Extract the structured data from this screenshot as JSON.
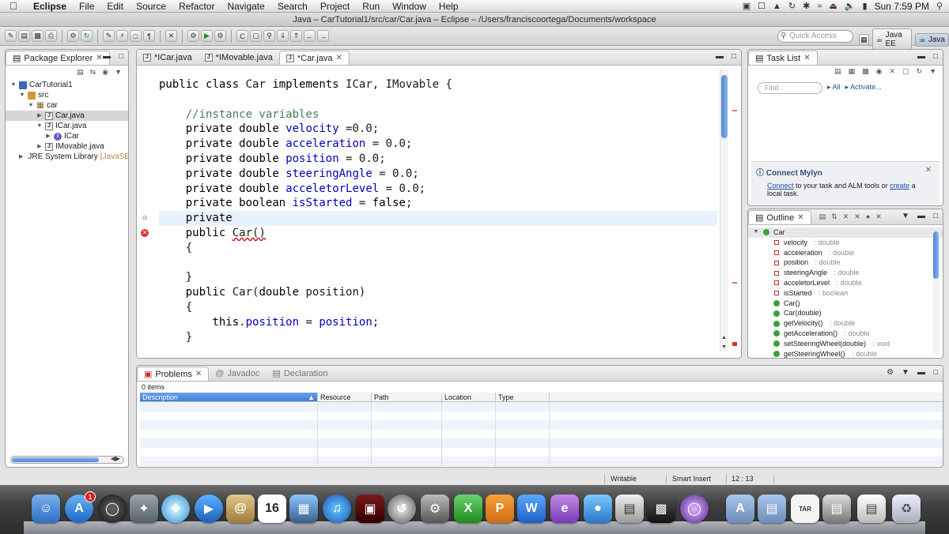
{
  "menubar": {
    "app": "Eclipse",
    "items": [
      "File",
      "Edit",
      "Source",
      "Refactor",
      "Navigate",
      "Search",
      "Project",
      "Run",
      "Window",
      "Help"
    ],
    "clock": "Sun 7:59 PM"
  },
  "window": {
    "title": "Java – CarTutorial1/src/car/Car.java – Eclipse – /Users/franciscoortega/Documents/workspace"
  },
  "toolbar": {
    "quick_access_placeholder": "Quick Access",
    "perspectives": [
      "Java EE",
      "Java"
    ]
  },
  "package_explorer": {
    "tab": "Package Explorer",
    "tree": [
      {
        "label": "CarTutorial1",
        "depth": 0,
        "icon": "project-icon",
        "expanded": true
      },
      {
        "label": "src",
        "depth": 1,
        "icon": "source-folder-icon",
        "expanded": true
      },
      {
        "label": "car",
        "depth": 2,
        "icon": "package-icon",
        "expanded": true
      },
      {
        "label": "Car.java",
        "depth": 3,
        "icon": "java-file-icon",
        "selected": true
      },
      {
        "label": "ICar.java",
        "depth": 3,
        "icon": "java-file-icon",
        "expanded": true
      },
      {
        "label": "ICar",
        "depth": 4,
        "icon": "interface-icon"
      },
      {
        "label": "IMovable.java",
        "depth": 3,
        "icon": "java-file-icon"
      },
      {
        "label": "JRE System Library",
        "suffix": "[JavaSE-",
        "depth": 1,
        "icon": "library-icon"
      }
    ]
  },
  "editor": {
    "tabs": [
      {
        "label": "*ICar.java",
        "active": false
      },
      {
        "label": "*IMovable.java",
        "active": false
      },
      {
        "label": "*Car.java",
        "active": true
      }
    ],
    "lines": [
      "public class Car implements ICar, IMovable {",
      "",
      "    //instance variables",
      "    private double velocity =0.0;",
      "    private double acceleration = 0.0;",
      "    private double position = 0.0;",
      "    private double steeringAngle = 0.0;",
      "    private double acceletorLevel = 0.0;",
      "    private boolean isStarted = false;",
      "    private",
      "    public Car()",
      "    {",
      "",
      "    }",
      "    public Car(double position)",
      "    {",
      "        this.position = position;",
      "    }"
    ],
    "current_line": 10,
    "error_line": 11
  },
  "task_list": {
    "tab": "Task List",
    "find_placeholder": "Find",
    "filter_all": "All",
    "activate": "Activate...",
    "mylyn": {
      "title": "Connect Mylyn",
      "text_link1": "Connect",
      "text_mid": " to your task and ALM tools or ",
      "text_link2": "create",
      "text_end": " a local task."
    }
  },
  "outline": {
    "tab": "Outline",
    "root": "Car",
    "members": [
      {
        "name": "velocity",
        "type": ": double",
        "kind": "field"
      },
      {
        "name": "acceleration",
        "type": ": double",
        "kind": "field"
      },
      {
        "name": "position",
        "type": ": double",
        "kind": "field"
      },
      {
        "name": "steeringAngle",
        "type": ": double",
        "kind": "field"
      },
      {
        "name": "acceletorLevel",
        "type": ": double",
        "kind": "field"
      },
      {
        "name": "isStarted",
        "type": ": boolean",
        "kind": "field"
      },
      {
        "name": "Car()",
        "type": "",
        "kind": "constructor"
      },
      {
        "name": "Car(double)",
        "type": "",
        "kind": "constructor"
      },
      {
        "name": "getVelocity()",
        "type": ": double",
        "kind": "method"
      },
      {
        "name": "getAcceleration()",
        "type": ": double",
        "kind": "method"
      },
      {
        "name": "setSteeringWheel(double)",
        "type": ": void",
        "kind": "method"
      },
      {
        "name": "getSteeringWheel()",
        "type": ": double",
        "kind": "method"
      }
    ]
  },
  "problems": {
    "tabs": [
      "Problems",
      "Javadoc",
      "Declaration"
    ],
    "count": "0 items",
    "columns": [
      "Description",
      "Resource",
      "Path",
      "Location",
      "Type"
    ]
  },
  "status": {
    "mode": "Writable",
    "insert": "Smart Insert",
    "position": "12 : 13"
  },
  "dock": {
    "mail_badge": "1"
  }
}
